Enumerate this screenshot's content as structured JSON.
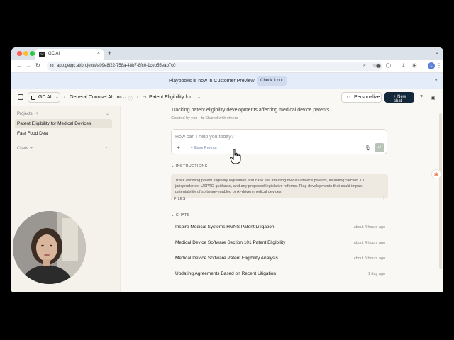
{
  "browser": {
    "tab_title": "GC AI",
    "tab_close": "×",
    "new_tab": "+",
    "url": "app.getgc.ai/projects/a09e8f22-758a-48b7-8fc0-1ceb55eab7c0",
    "profile_initial": "L"
  },
  "banner": {
    "text": "Playbooks is now in Customer Preview",
    "button": "Check it out",
    "close": "×"
  },
  "header": {
    "org": "GC AI",
    "breadcrumbs": [
      "General Counsel AI, Inc.",
      "Patent Eligibility for ..."
    ],
    "personalize": "Personalize",
    "new_chat": "+ New chat"
  },
  "sidebar": {
    "projects_label": "Projects",
    "projects": [
      {
        "label": "Patent Eligibility for Medical Devices",
        "active": true
      },
      {
        "label": "Fast Food Deal",
        "active": false
      }
    ],
    "chats_label": "Chats"
  },
  "main": {
    "description": "Tracking patent eligibility developments affecting medical device patents",
    "created_by": "Created by you",
    "shared": "Shared with others",
    "prompt_placeholder": "How can I help you today?",
    "easy_prompt": "Easy Prompt",
    "instructions_label": "INSTRUCTIONS",
    "instructions_text": "Track evolving patent eligibility legislation and case law affecting medical device patents, including Section 101 jurisprudence, USPTO guidance, and any proposed legislative reforms. Flag developments that could impact patentability of software-enabled or AI-driven medical devices",
    "files_label": "FILES",
    "chats_label": "CHATS",
    "chats": [
      {
        "title": "Inspire Medical Systems HGNS Patent Litigation",
        "time": "about 4 hours ago"
      },
      {
        "title": "Medical Device Software Section 101 Patent Eligibility",
        "time": "about 4 hours ago"
      },
      {
        "title": "Medical Device Software Patent Eligibility Analysis",
        "time": "about 5 hours ago"
      },
      {
        "title": "Updating Agreements Based on Recent Litigation",
        "time": "1 day ago"
      }
    ]
  },
  "colors": {
    "new_chat_bg": "#14283a",
    "banner_bg": "#e3ecf8",
    "sidebar_active": "#e9e4da",
    "hubspot": "#f26b3a"
  }
}
